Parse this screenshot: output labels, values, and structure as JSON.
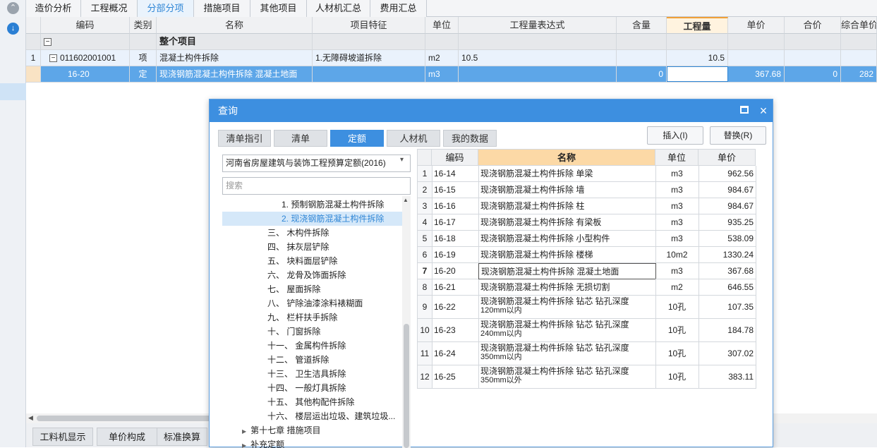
{
  "main_tabs": [
    "造价分析",
    "工程概况",
    "分部分项",
    "措施项目",
    "其他项目",
    "人材机汇总",
    "费用汇总"
  ],
  "grid": {
    "headers": [
      "编码",
      "类别",
      "名称",
      "项目特征",
      "单位",
      "工程量表达式",
      "含量",
      "工程量",
      "单价",
      "合价",
      "综合单价"
    ],
    "rows": [
      {
        "num": "",
        "code": "",
        "type": "",
        "name": "整个项目",
        "feature": "",
        "unit": "",
        "expr": "",
        "content": "",
        "qty": "",
        "price": "",
        "total": "",
        "comp": ""
      },
      {
        "num": "1",
        "code": "011602001001",
        "type": "项",
        "name": "混凝土构件拆除",
        "feature": "1.无障碍坡道拆除",
        "unit": "m2",
        "expr": "10.5",
        "content": "",
        "qty": "10.5",
        "price": "",
        "total": "",
        "comp": ""
      },
      {
        "num": "",
        "code": "16-20",
        "type": "定",
        "name": "现浇钢筋混凝土构件拆除 混凝土地面",
        "feature": "",
        "unit": "m3",
        "expr": "",
        "content": "0",
        "qty": "",
        "price": "367.68",
        "total": "0",
        "comp": "282"
      }
    ]
  },
  "bottom_tabs": [
    "工料机显示",
    "单价构成",
    "标准换算"
  ],
  "dialog": {
    "title": "查询",
    "tabs": [
      "清单指引",
      "清单",
      "定额",
      "人材机",
      "我的数据"
    ],
    "insert_label": "插入(I)",
    "replace_label": "替换(R)",
    "library": "河南省房屋建筑与装饰工程预算定额(2016)",
    "search_placeholder": "搜索",
    "tree": [
      "1. 预制钢筋混凝土构件拆除",
      "2. 现浇钢筋混凝土构件拆除",
      "三、 木构件拆除",
      "四、 抹灰层铲除",
      "五、 块料面层铲除",
      "六、 龙骨及饰面拆除",
      "七、 屋面拆除",
      "八、 铲除油漆涂料裱糊面",
      "九、 栏杆扶手拆除",
      "十、 门窗拆除",
      "十一、 金属构件拆除",
      "十二、 管道拆除",
      "十三、 卫生洁具拆除",
      "十四、 一般灯具拆除",
      "十五、 其他构配件拆除",
      "十六、 楼层运出垃圾、建筑垃圾...",
      "第十七章 措施项目",
      "补充定额"
    ],
    "table_headers": [
      "编码",
      "名称",
      "单位",
      "单价"
    ],
    "rows": [
      {
        "n": "1",
        "code": "16-14",
        "name": "现浇钢筋混凝土构件拆除 单梁",
        "unit": "m3",
        "price": "962.56"
      },
      {
        "n": "2",
        "code": "16-15",
        "name": "现浇钢筋混凝土构件拆除 墙",
        "unit": "m3",
        "price": "984.67"
      },
      {
        "n": "3",
        "code": "16-16",
        "name": "现浇钢筋混凝土构件拆除 柱",
        "unit": "m3",
        "price": "984.67"
      },
      {
        "n": "4",
        "code": "16-17",
        "name": "现浇钢筋混凝土构件拆除 有梁板",
        "unit": "m3",
        "price": "935.25"
      },
      {
        "n": "5",
        "code": "16-18",
        "name": "现浇钢筋混凝土构件拆除 小型构件",
        "unit": "m3",
        "price": "538.09"
      },
      {
        "n": "6",
        "code": "16-19",
        "name": "现浇钢筋混凝土构件拆除 楼梯",
        "unit": "10m2",
        "price": "1330.24"
      },
      {
        "n": "7",
        "code": "16-20",
        "name": "现浇钢筋混凝土构件拆除 混凝土地面",
        "unit": "m3",
        "price": "367.68"
      },
      {
        "n": "8",
        "code": "16-21",
        "name": "现浇钢筋混凝土构件拆除 无损切割",
        "unit": "m2",
        "price": "646.55"
      },
      {
        "n": "9",
        "code": "16-22",
        "name": "现浇钢筋混凝土构件拆除 钻芯 钻孔深度",
        "name2": "120mm以内",
        "unit": "10孔",
        "price": "107.35"
      },
      {
        "n": "10",
        "code": "16-23",
        "name": "现浇钢筋混凝土构件拆除 钻芯 钻孔深度",
        "name2": "240mm以内",
        "unit": "10孔",
        "price": "184.78"
      },
      {
        "n": "11",
        "code": "16-24",
        "name": "现浇钢筋混凝土构件拆除 钻芯 钻孔深度",
        "name2": "350mm以内",
        "unit": "10孔",
        "price": "307.02"
      },
      {
        "n": "12",
        "code": "16-25",
        "name": "现浇钢筋混凝土构件拆除 钻芯 钻孔深度",
        "name2": "350mm以外",
        "unit": "10孔",
        "price": "383.11"
      }
    ]
  }
}
